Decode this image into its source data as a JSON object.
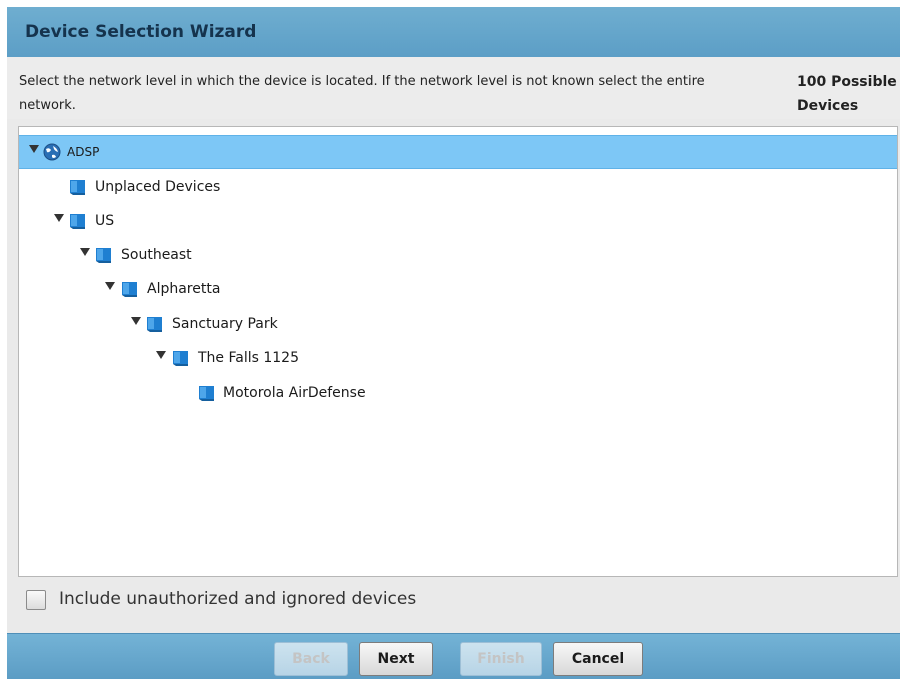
{
  "dialog": {
    "title": "Device Selection Wizard",
    "instructions": "Select the network level in which the device is located. If the network level is not known select the entire network.",
    "possible_devices": "100 Possible Devices"
  },
  "tree": {
    "nodes": [
      {
        "label": "ADSP",
        "expanded": true,
        "selected": true,
        "icon": "globe-icon"
      },
      {
        "label": "Unplaced Devices",
        "expanded": false,
        "icon": "folder-icon"
      },
      {
        "label": "US",
        "expanded": true,
        "icon": "folder-icon"
      },
      {
        "label": "Southeast",
        "expanded": true,
        "icon": "folder-icon"
      },
      {
        "label": "Alpharetta",
        "expanded": true,
        "icon": "folder-icon"
      },
      {
        "label": "Sanctuary Park",
        "expanded": true,
        "icon": "folder-icon"
      },
      {
        "label": "The Falls 1125",
        "expanded": true,
        "icon": "folder-icon"
      },
      {
        "label": "Motorola AirDefense",
        "expanded": false,
        "icon": "folder-icon"
      }
    ]
  },
  "options": {
    "include_unauthorized_label": "Include unauthorized and ignored devices",
    "include_unauthorized_checked": false
  },
  "footer": {
    "back_label": "Back",
    "next_label": "Next",
    "finish_label": "Finish",
    "cancel_label": "Cancel"
  },
  "colors": {
    "title_bar": "#5c9ec6",
    "selection": "#7dc7f6",
    "node_icon": "#1f7fd1"
  }
}
